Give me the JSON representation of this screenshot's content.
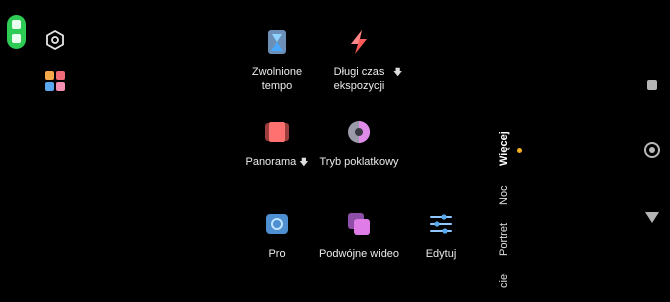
{
  "modes": [
    {
      "key": "slowmo",
      "label": "Zwolnione\ntempo"
    },
    {
      "key": "longexp",
      "label": "Długi czas\nekspozycji",
      "download": "🡇"
    },
    {
      "key": "panorama",
      "label": "Panorama",
      "download": "🡇"
    },
    {
      "key": "timelapse",
      "label": "Tryb poklatkowy"
    },
    {
      "key": "pro",
      "label": "Pro"
    },
    {
      "key": "dualvideo",
      "label": "Podwójne wideo"
    },
    {
      "key": "edit",
      "label": "Edytuj"
    }
  ],
  "mode_bar": {
    "items": [
      "Więcej",
      "Noc",
      "Portret",
      "cie"
    ],
    "active": "Więcej"
  },
  "colors": {
    "status_green": "#2ecc55",
    "active_dot": "#f5b021"
  },
  "icons": {
    "settings": "settings-hexagon-icon",
    "grid": "app-grid-icon",
    "square": "square-icon",
    "shutter": "shutter-icon",
    "back": "triangle-down-icon"
  }
}
